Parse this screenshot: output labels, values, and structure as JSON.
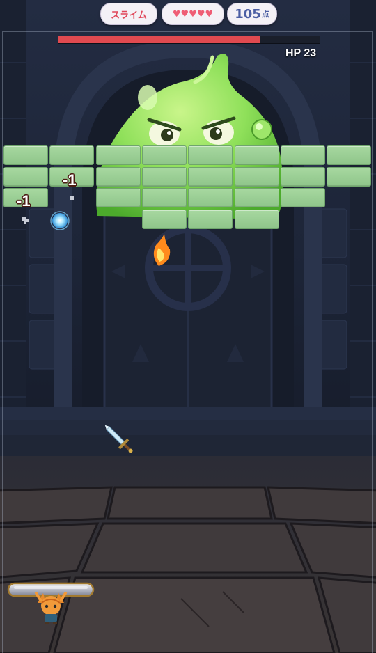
{
  "hud": {
    "enemy_name": "スライム",
    "lives_hearts": "♥♥♥♥♥",
    "score_value": "105",
    "score_unit": "点"
  },
  "boss": {
    "hp_label": "HP 23",
    "hp_fraction": 0.77,
    "bar_color": "#e04a50"
  },
  "bricks": {
    "color": "#9fd29a",
    "rows": [
      [
        1,
        1,
        1,
        1,
        1,
        1,
        1,
        1
      ],
      [
        1,
        1,
        1,
        1,
        1,
        1,
        1,
        1
      ],
      [
        1,
        0,
        1,
        1,
        1,
        1,
        1,
        0
      ],
      [
        0,
        0,
        0,
        1,
        1,
        1,
        0,
        0
      ]
    ]
  },
  "damage_popups": [
    {
      "text": "-1"
    },
    {
      "text": "-1"
    }
  ],
  "colors": {
    "background": "#1b2233",
    "slime": "#7ed957",
    "paddle": "#c9cbd6"
  }
}
